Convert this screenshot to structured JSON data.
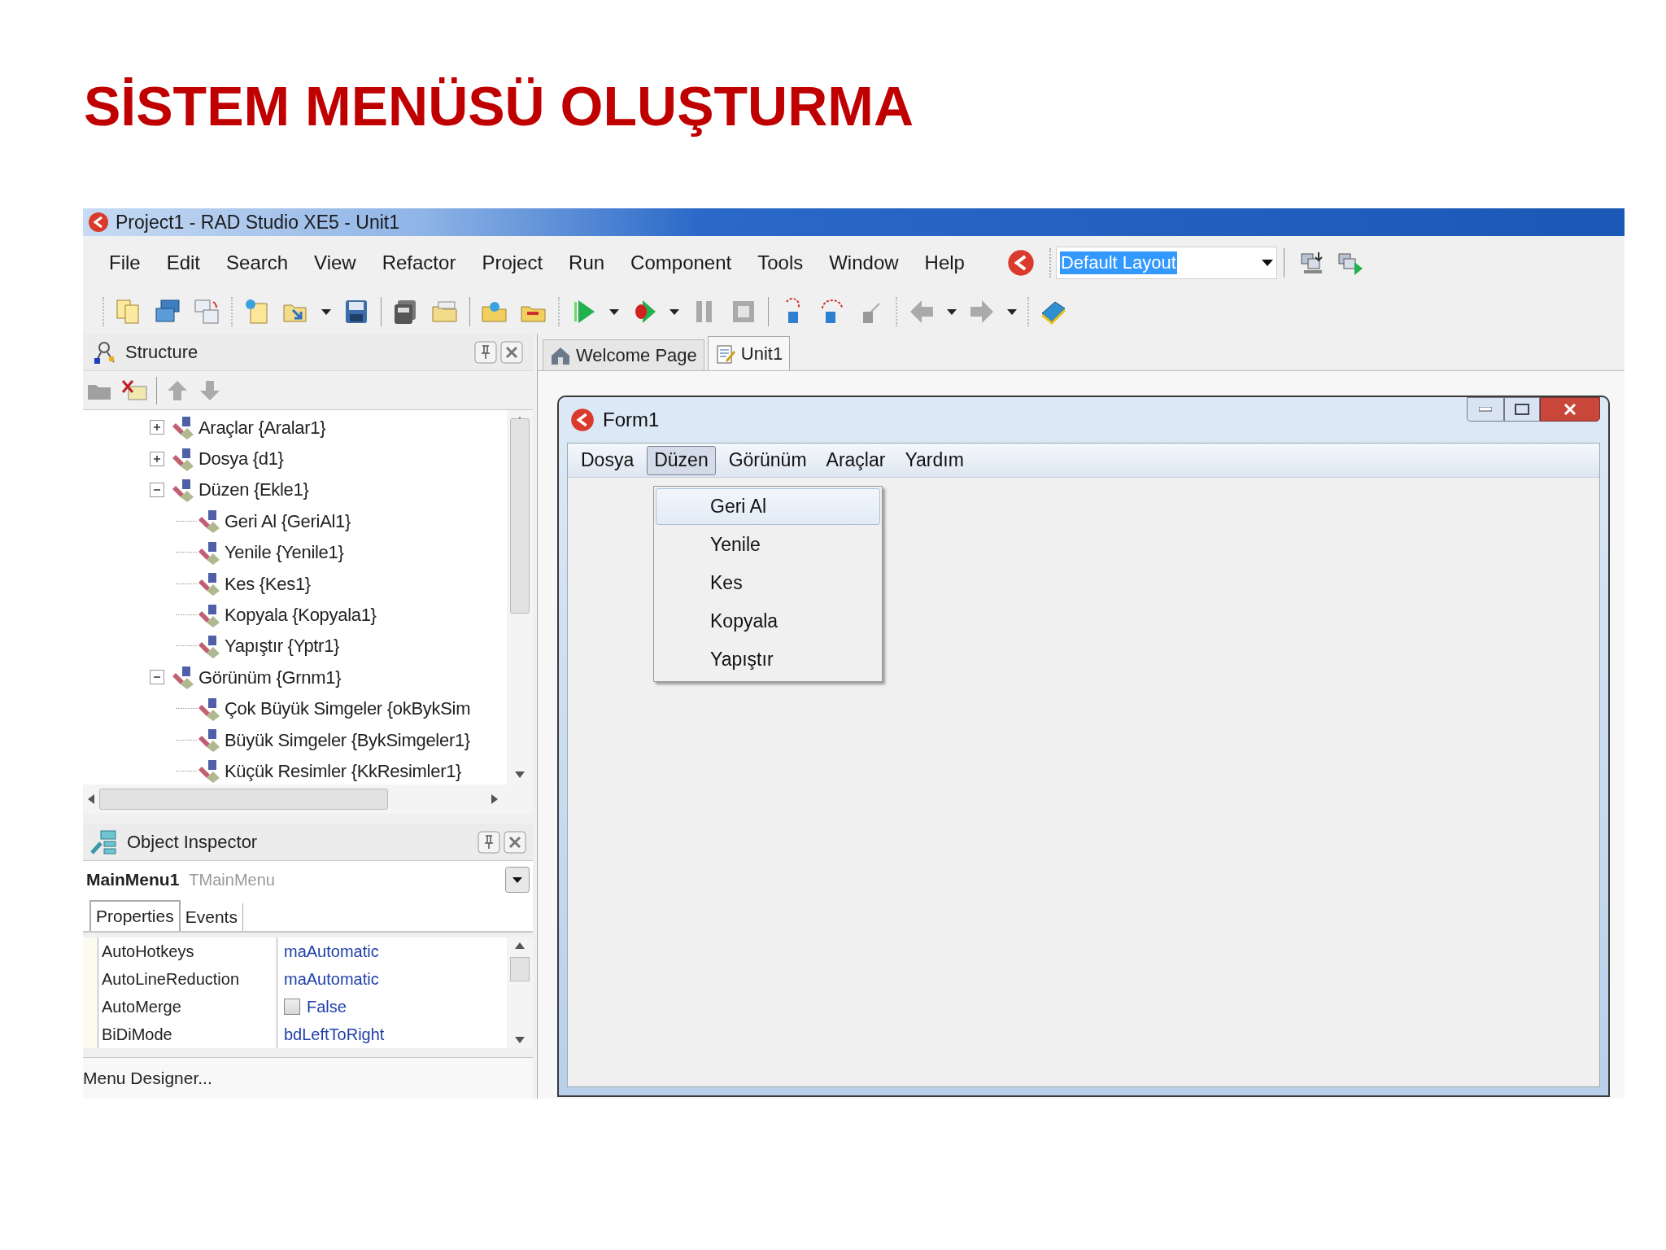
{
  "slide_title": "SİSTEM MENÜSÜ OLUŞTURMA",
  "window": {
    "title": "Project1 - RAD Studio XE5 - Unit1"
  },
  "menu": [
    "File",
    "Edit",
    "Search",
    "View",
    "Refactor",
    "Project",
    "Run",
    "Component",
    "Tools",
    "Window",
    "Help"
  ],
  "layout_combo": {
    "value": "Default Layout"
  },
  "structure": {
    "title": "Structure",
    "tree": [
      {
        "label": "Araçlar {Aralar1}",
        "expanded": false
      },
      {
        "label": "Dosya {d1}",
        "expanded": false
      },
      {
        "label": "Düzen {Ekle1}",
        "expanded": true,
        "children": [
          {
            "label": "Geri Al {GeriAl1}"
          },
          {
            "label": "Yenile {Yenile1}"
          },
          {
            "label": "Kes {Kes1}"
          },
          {
            "label": "Kopyala {Kopyala1}"
          },
          {
            "label": "Yapıştır {Yptr1}"
          }
        ]
      },
      {
        "label": "Görünüm {Grnm1}",
        "expanded": true,
        "children": [
          {
            "label": "Çok Büyük Simgeler {okBykSim"
          },
          {
            "label": "Büyük Simgeler {BykSimgeler1}"
          },
          {
            "label": "Küçük Resimler {KkResimler1}"
          }
        ]
      }
    ]
  },
  "object_inspector": {
    "title": "Object Inspector",
    "component": "MainMenu1",
    "component_type": "TMainMenu",
    "tabs": [
      {
        "label": "Properties",
        "selected": true
      },
      {
        "label": "Events",
        "selected": false
      }
    ],
    "properties": [
      {
        "name": "AutoHotkeys",
        "value": "maAutomatic",
        "kind": "text"
      },
      {
        "name": "AutoLineReduction",
        "value": "maAutomatic",
        "kind": "text"
      },
      {
        "name": "AutoMerge",
        "value": "False",
        "kind": "checkbox",
        "checked": false
      },
      {
        "name": "BiDiMode",
        "value": "bdLeftToRight",
        "kind": "text"
      }
    ],
    "status": "Menu Designer..."
  },
  "editor_tabs": [
    {
      "label": "Welcome Page",
      "selected": false
    },
    {
      "label": "Unit1",
      "selected": true
    }
  ],
  "form": {
    "title": "Form1",
    "menu": [
      {
        "label": "Dosya",
        "selected": false
      },
      {
        "label": "Düzen",
        "selected": true
      },
      {
        "label": "Görünüm",
        "selected": false
      },
      {
        "label": "Araçlar",
        "selected": false
      },
      {
        "label": "Yardım",
        "selected": false
      }
    ],
    "dropdown": [
      {
        "label": "Geri Al",
        "selected": true
      },
      {
        "label": "Yenile",
        "selected": false
      },
      {
        "label": "Kes",
        "selected": false
      },
      {
        "label": "Kopyala",
        "selected": false
      },
      {
        "label": "Yapıştır",
        "selected": false
      }
    ]
  }
}
